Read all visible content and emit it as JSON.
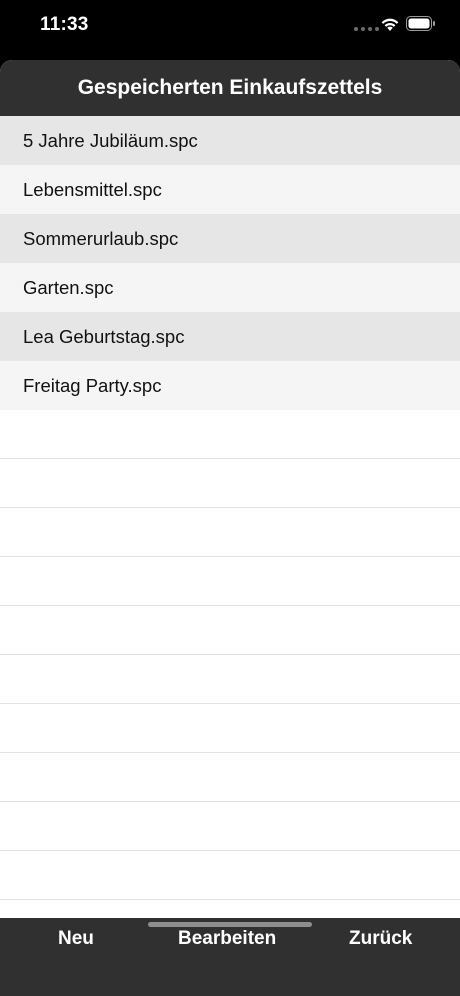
{
  "status_bar": {
    "time": "11:33"
  },
  "nav": {
    "title": "Gespeicherten Einkaufszettels"
  },
  "files": [
    {
      "name": "5 Jahre Jubiläum.spc"
    },
    {
      "name": "Lebensmittel.spc"
    },
    {
      "name": "Sommerurlaub.spc"
    },
    {
      "name": "Garten.spc"
    },
    {
      "name": "Lea Geburtstag.spc"
    },
    {
      "name": "Freitag Party.spc"
    }
  ],
  "toolbar": {
    "new_label": "Neu",
    "edit_label": "Bearbeiten",
    "back_label": "Zurück"
  },
  "colors": {
    "bar_background": "#303030",
    "row_odd": "#e6e6e6",
    "row_even": "#f5f5f5"
  },
  "icons": {
    "wifi": "wifi-icon",
    "battery": "battery-icon",
    "signal": "signal-icon"
  }
}
